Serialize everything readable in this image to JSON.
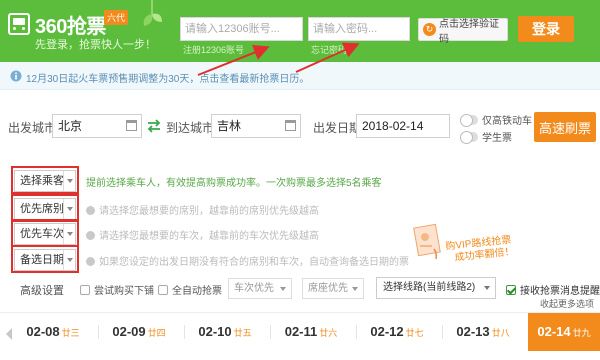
{
  "header": {
    "logo_text": "360抢票",
    "logo_badge": "六代",
    "slogan": "先登录，抢票快人一步！",
    "account_placeholder": "请输入12306账号...",
    "account_sublink": "注册12306账号",
    "password_placeholder": "请输入密码...",
    "password_sublink": "忘记密码",
    "captcha_label": "点击选择验证码",
    "captcha_icon_glyph": "↻",
    "login_label": "登录"
  },
  "notice": {
    "text": "12月30日起火车票预售期调整为30天，点击查看最新抢票日历。"
  },
  "search": {
    "from_label": "出发城市",
    "from_value": "北京",
    "to_label": "到达城市",
    "to_value": "吉林",
    "date_label": "出发日期",
    "date_value": "2018-02-14",
    "option_high_speed": "仅高铁动车",
    "option_student": "学生票",
    "search_button": "高速刷票"
  },
  "options": [
    {
      "select": "选择乘客",
      "hint": "提前选择乘车人，有效提高购票成功率。一次购票最多选择5名乘客",
      "green": true
    },
    {
      "select": "优先席别",
      "hint": "请选择您最想要的席别，越靠前的席别优先级越高",
      "green": false
    },
    {
      "select": "优先车次",
      "hint": "请选择您最想要的车次，越靠前的车次优先级越高",
      "green": false
    },
    {
      "select": "备选日期",
      "hint": "如果您设定的出发日期没有符合的席别和车次，自动查询备选日期的票",
      "green": false
    }
  ],
  "vip": {
    "line1": "购VIP路线抢票",
    "line2": "成功率翻倍！"
  },
  "advanced": {
    "label": "高级设置",
    "try_buy_lower": "尝试购买下铺",
    "auto_all": "全自动抢票",
    "train_priority": "车次优先",
    "seat_priority": "席座优先",
    "route_select": "选择线路(当前线路2)",
    "notify": "接收抢票消息提醒",
    "more_link": "收起更多选项"
  },
  "dates": [
    {
      "date": "02-08",
      "lunar": "廿三",
      "active": false
    },
    {
      "date": "02-09",
      "lunar": "廿四",
      "active": false
    },
    {
      "date": "02-10",
      "lunar": "廿五",
      "active": false
    },
    {
      "date": "02-11",
      "lunar": "廿六",
      "active": false
    },
    {
      "date": "02-12",
      "lunar": "廿七",
      "active": false
    },
    {
      "date": "02-13",
      "lunar": "廿八",
      "active": false
    },
    {
      "date": "02-14",
      "lunar": "廿九",
      "active": true
    }
  ],
  "colors": {
    "header_green": "#5cbd3d",
    "accent_orange": "#f28b1c",
    "annotation_red": "#e0302e"
  }
}
